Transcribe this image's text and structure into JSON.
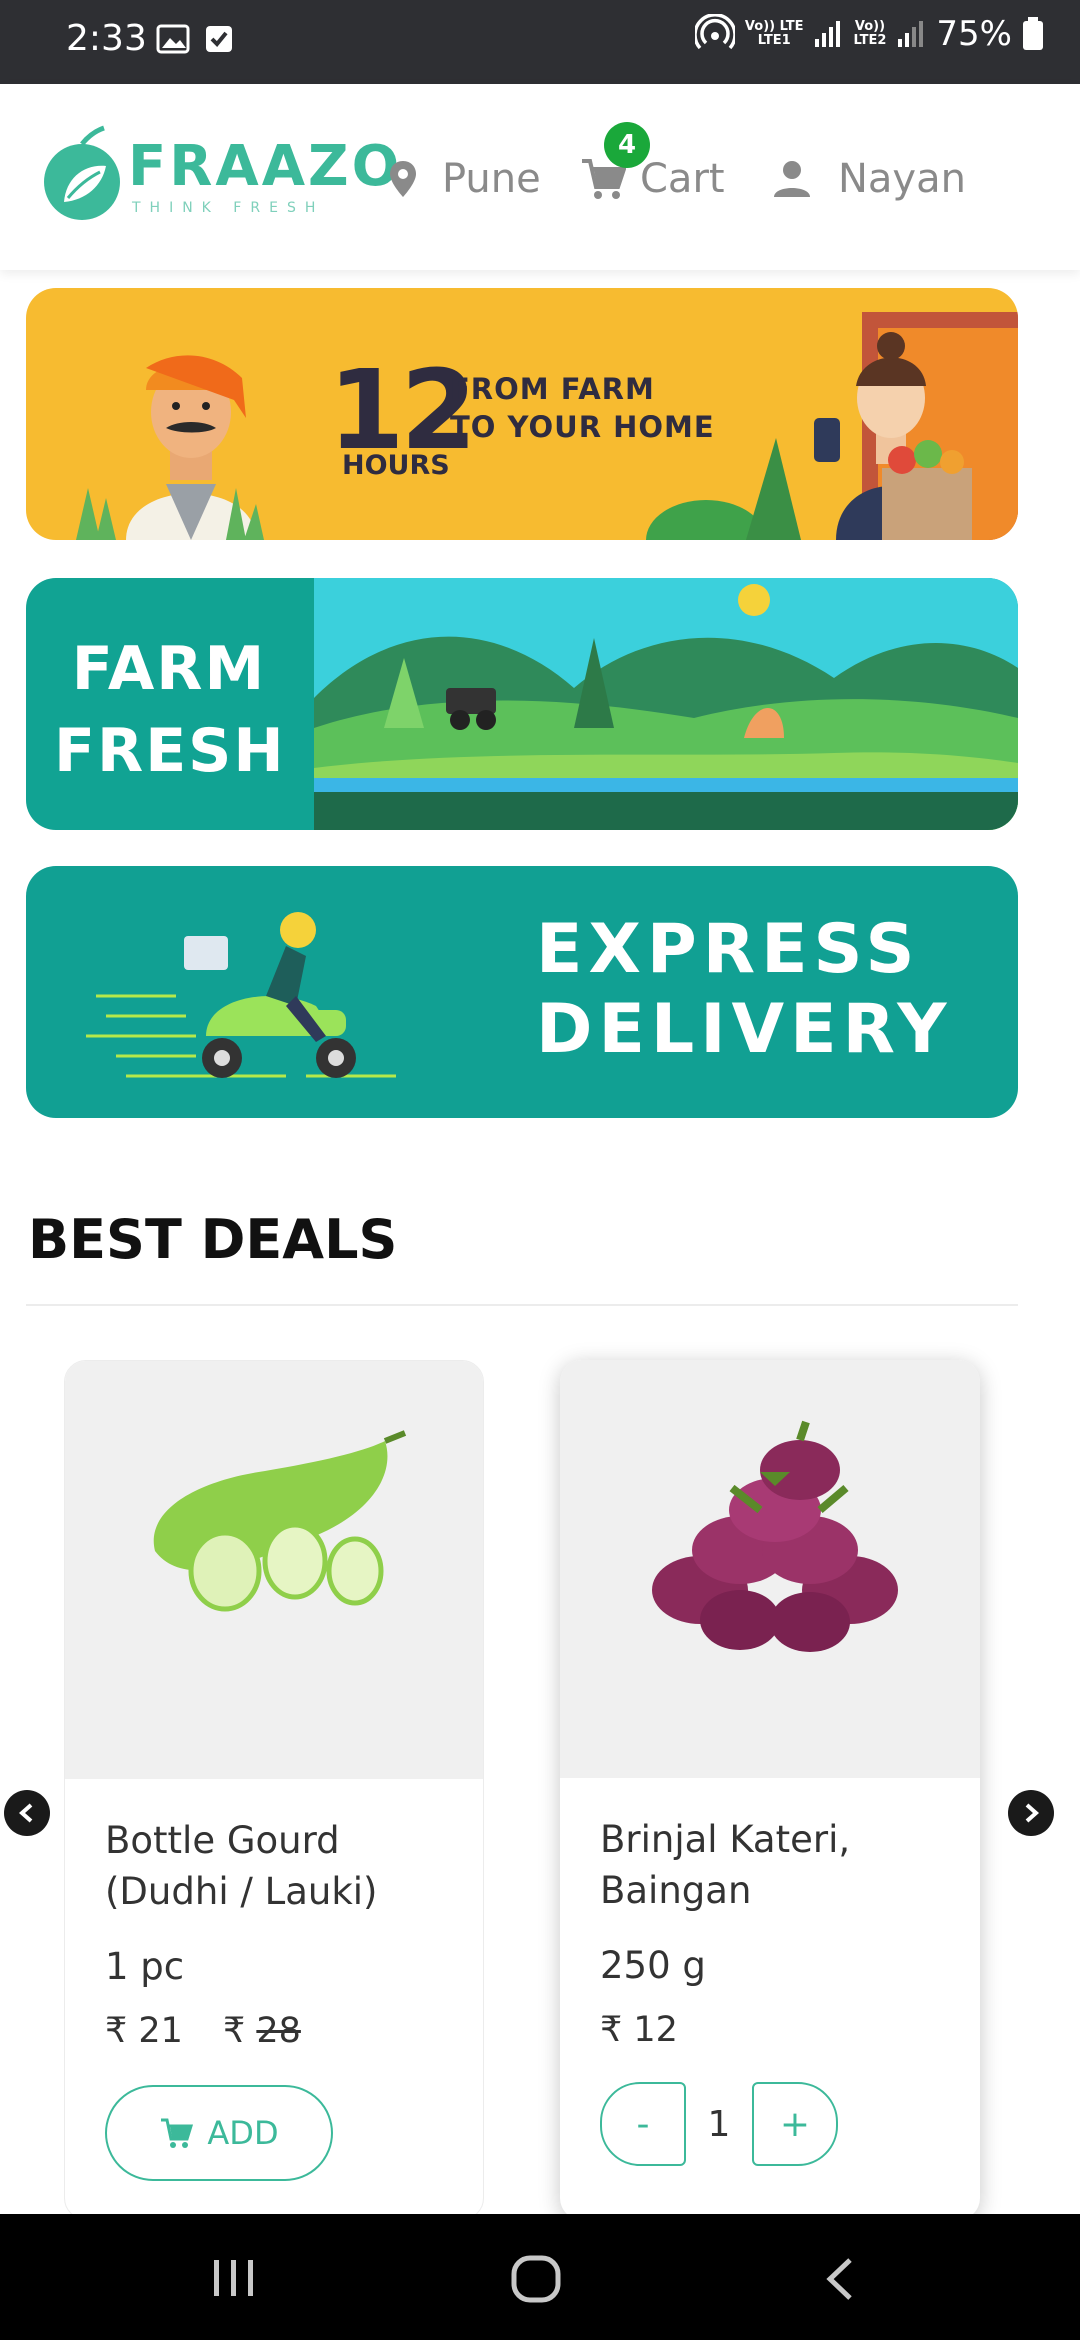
{
  "status_bar": {
    "time": "2:33",
    "carrier1": "Vo)) LTE",
    "carrier1_sub": "LTE1",
    "carrier2": "Vo))",
    "carrier2_sub": "LTE2",
    "battery": "75%"
  },
  "header": {
    "brand": "FRAAZO",
    "tagline": "THINK FRESH",
    "location": "Pune",
    "cart_label": "Cart",
    "cart_count": "4",
    "user": "Nayan"
  },
  "banners": {
    "b1_number": "12",
    "b1_hours": "HOURS",
    "b1_line1": "FROM FARM",
    "b1_line2": "TO YOUR HOME",
    "b2_line1": "FARM",
    "b2_line2": "FRESH",
    "b3_line1": "EXPRESS",
    "b3_line2": "DELIVERY"
  },
  "deals": {
    "title": "BEST DEALS",
    "products": [
      {
        "name": "Bottle Gourd (Dudhi / Lauki)",
        "qty": "1 pc",
        "price": "₹ 21",
        "mrp": "28",
        "mrp_symbol": "₹",
        "add_label": "ADD"
      },
      {
        "name": "Brinjal Kateri, Baingan",
        "qty": "250 g",
        "price": "₹ 12",
        "minus": "-",
        "count": "1",
        "plus": "+"
      }
    ]
  },
  "colors": {
    "brand_green": "#3cb99a",
    "teal_banner": "#11a393",
    "yellow_banner": "#f7bb30",
    "cart_badge": "#1aa83a"
  }
}
